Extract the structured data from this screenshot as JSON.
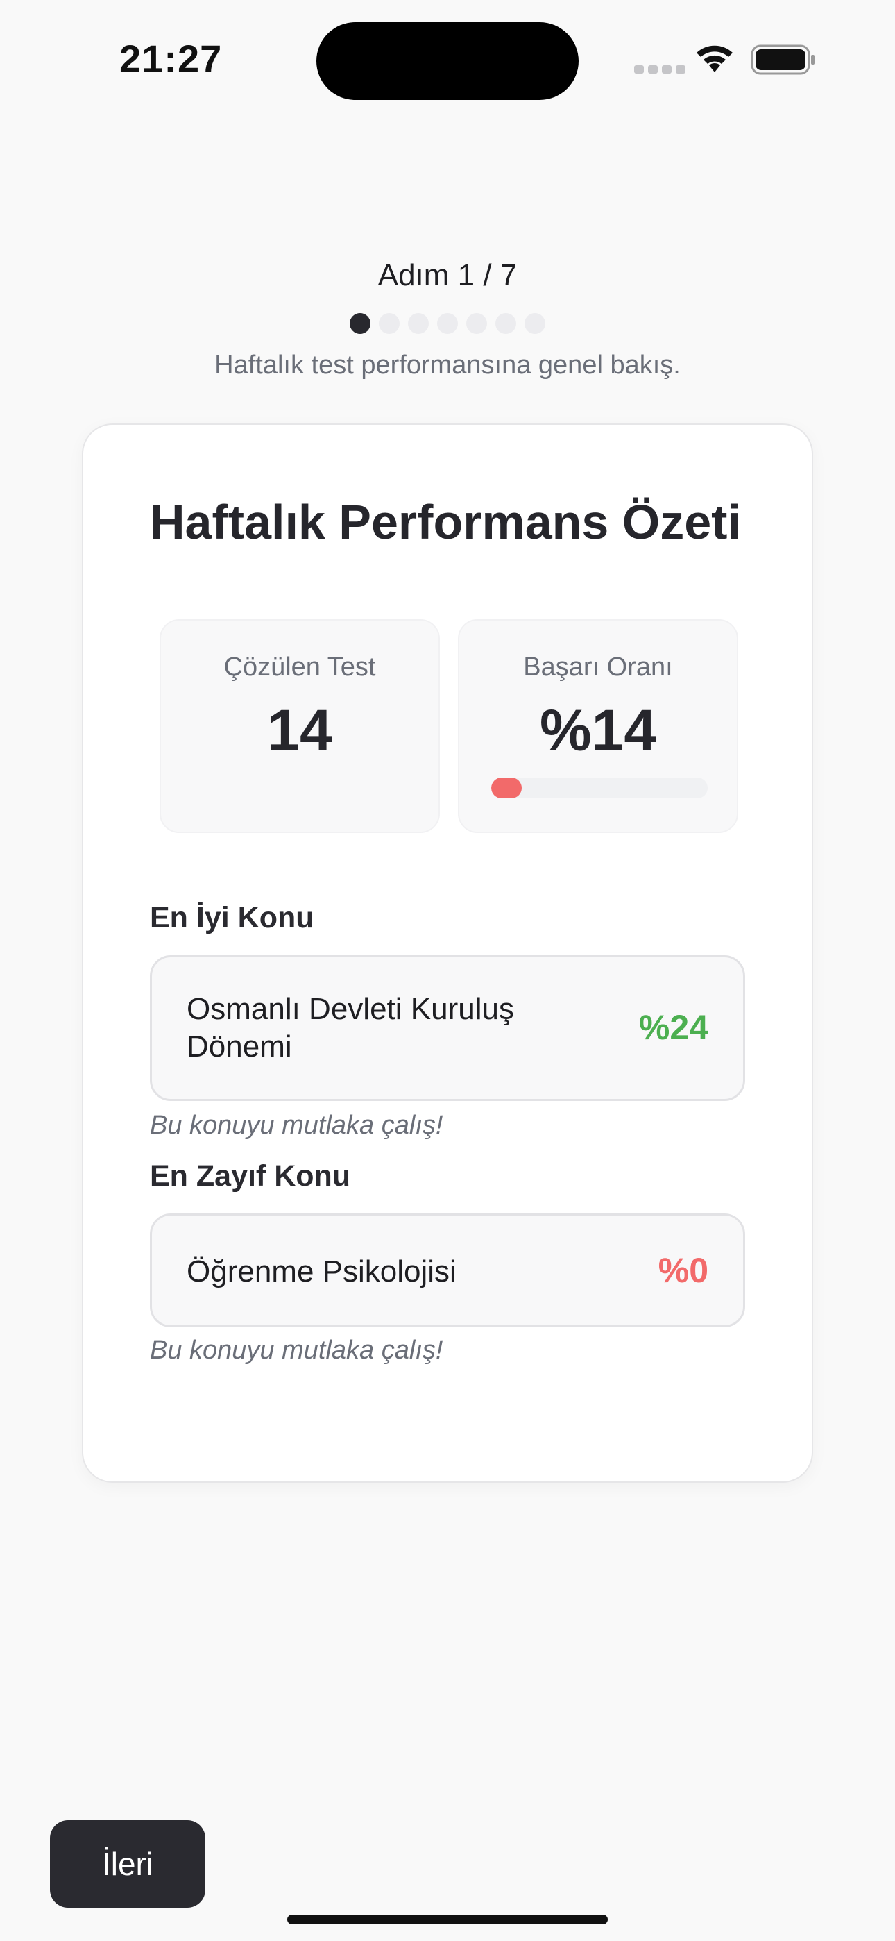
{
  "status_bar": {
    "time": "21:27"
  },
  "step": {
    "title": "Adım 1 / 7",
    "description": "Haftalık test performansına genel bakış.",
    "total_steps": 7,
    "current_step": 1
  },
  "card": {
    "title": "Haftalık Performans Özeti",
    "stats": {
      "solved_label": "Çözülen Test",
      "solved_value": "14",
      "success_label": "Başarı Oranı",
      "success_value": "%14",
      "success_fraction": 0.14
    },
    "best": {
      "label": "En İyi Konu",
      "topic_line1": "Osmanlı Devleti Kuruluş",
      "topic_line2": "Dönemi",
      "percent": "%24",
      "note": "Bu konuyu mutlaka çalış!"
    },
    "weakest": {
      "label": "En Zayıf Konu",
      "topic": "Öğrenme Psikolojisi",
      "percent": "%0",
      "note": "Bu konuyu mutlaka çalış!"
    }
  },
  "footer": {
    "next_label": "İleri"
  },
  "colors": {
    "good": "#4caf50",
    "bad": "#f26a6a",
    "progress_fill": "#f26a6a"
  }
}
